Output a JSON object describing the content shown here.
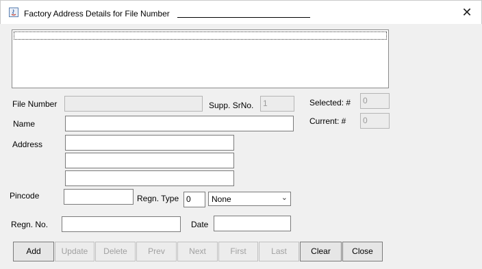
{
  "window": {
    "title": "Factory Address Details for File Number",
    "close_symbol": "✕",
    "icon": "java-app-icon"
  },
  "labels": {
    "file_number": "File Number",
    "supp_srno": "Supp. SrNo.",
    "selected": "Selected: #",
    "current": "Current: #",
    "name": "Name",
    "address": "Address",
    "pincode": "Pincode",
    "regn_type": "Regn. Type",
    "regn_no": "Regn. No.",
    "date": "Date"
  },
  "fields": {
    "file_number": "",
    "supp_srno": "1",
    "selected": "0",
    "current": "0",
    "name": "",
    "address_line1": "",
    "address_line2": "",
    "address_line3": "",
    "pincode": "",
    "regn_type_code": "0",
    "regn_type_select": "None",
    "regn_no": "",
    "date": ""
  },
  "buttons": {
    "add": "Add",
    "update": "Update",
    "delete": "Delete",
    "prev": "Prev",
    "next": "Next",
    "first": "First",
    "last": "Last",
    "clear": "Clear",
    "close": "Close"
  }
}
